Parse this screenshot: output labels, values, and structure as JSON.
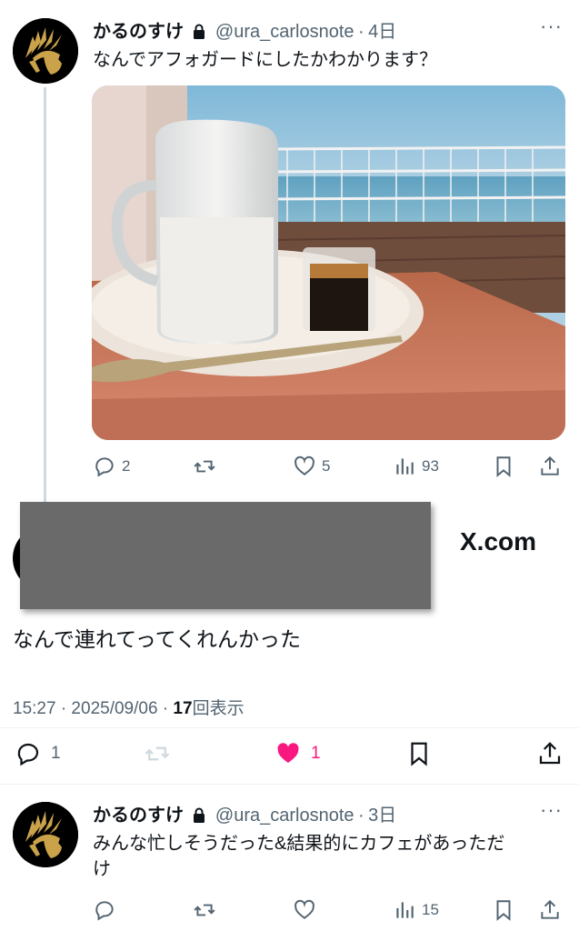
{
  "tweet1": {
    "display_name": "かるのすけ",
    "handle": "@ura_carlosnote",
    "time": "4日",
    "text": "なんでアフォガードにしたかわかります？",
    "replies": "2",
    "likes": "5",
    "views": "93"
  },
  "main": {
    "source_label": "X.com",
    "text": "なんで連れてってくれんかった",
    "meta_time": "15:27 · 2025/09/06 · ",
    "meta_views_count": "17",
    "meta_views_label": "回表示",
    "replies": "1",
    "likes": "1"
  },
  "tweet2": {
    "display_name": "かるのすけ",
    "handle": "@ura_carlosnote",
    "time": "3日",
    "text_line1": "みんな忙しそうだった&結果的にカフェがあっただ",
    "text_line2": "け",
    "views": "15"
  },
  "colors": {
    "accent_like": "#f91880",
    "muted": "#536471",
    "thread_line": "#cfd9de",
    "redaction": "#6a6a6a"
  }
}
